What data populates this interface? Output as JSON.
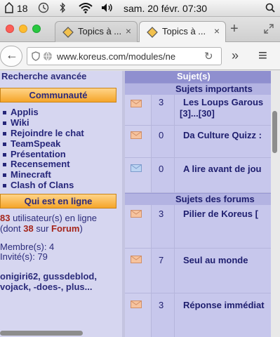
{
  "menubar": {
    "badge_count": "18",
    "datetime": "sam. 20 févr.  07:30"
  },
  "tabs": [
    {
      "label": "Topics à ...",
      "close": "×"
    },
    {
      "label": "Topics à ...",
      "close": "×"
    }
  ],
  "tabstrip": {
    "new_tab": "+"
  },
  "navbar": {
    "url": "www.koreus.com/modules/ne",
    "reload": "↻",
    "more": "»",
    "menu": "≡",
    "back": "←"
  },
  "sidebar": {
    "search_link": "Recherche avancée",
    "community_header": "Communauté",
    "community_items": [
      "Applis",
      "Wiki",
      "Rejoindre le chat",
      "TeamSpeak",
      "Présentation",
      "Recensement",
      "Minecraft",
      "Clash of Clans"
    ],
    "online_header": "Qui est en ligne",
    "online_count": "83",
    "online_text": "utilisateur(s) en ligne",
    "forum_prefix": "(dont",
    "forum_count": "38",
    "forum_mid": "sur",
    "forum_link": "Forum",
    "forum_suffix": ")",
    "members": "Membre(s): 4",
    "guests": "Invité(s): 79",
    "users_line1": "onigiri62, gussdeblod,",
    "users_line2": "vojack, -does-, plus..."
  },
  "main": {
    "header_subjects": "Sujet(s)",
    "section_important": "Sujets importants",
    "section_forums": "Sujets des forums",
    "rows": [
      {
        "count": "3",
        "title": "Les Loups Garous",
        "pages_prefix": "[",
        "page_a": "3",
        "pages_mid": "]...[",
        "page_b": "30",
        "pages_suffix": "]"
      },
      {
        "count": "0",
        "title": "Da Culture Quizz :"
      },
      {
        "count": "0",
        "title": "A lire avant de jou"
      },
      {
        "count": "3",
        "title": "Pilier de Koreus ["
      },
      {
        "count": "7",
        "title": "Seul au monde"
      },
      {
        "count": "3",
        "title": "Réponse immédiat"
      }
    ]
  },
  "colors": {
    "sidebar_bg": "#d6d6f0",
    "main_bg": "#c7c7ec",
    "header_orange": "#f5a52a",
    "highlight_red": "#a5261c"
  }
}
